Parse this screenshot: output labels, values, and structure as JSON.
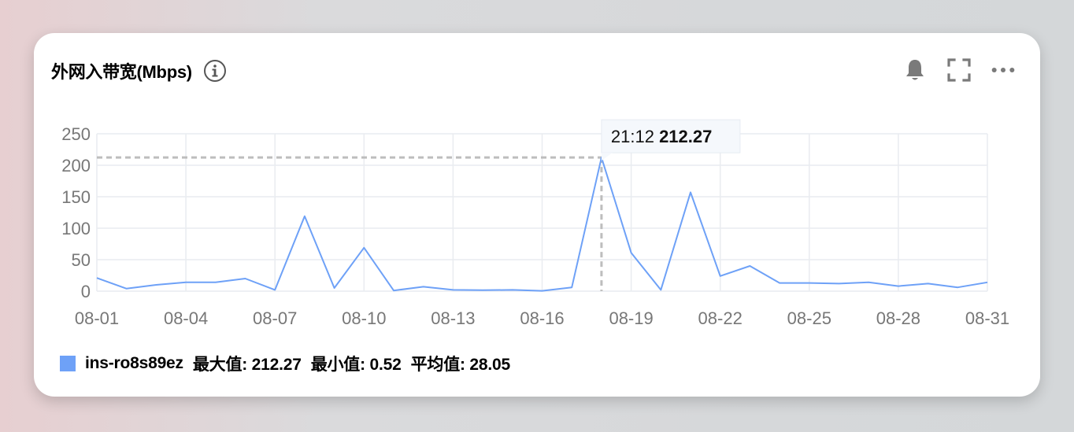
{
  "header": {
    "title": "外网入带宽(Mbps)"
  },
  "toolbar": {
    "icons": [
      "info-icon",
      "bell-icon",
      "fullscreen-icon",
      "more-icon"
    ]
  },
  "colors": {
    "series": "#6ea1f7",
    "grid": "#e9ecf0",
    "axis_text": "#777777",
    "crosshair": "#bdbdbd"
  },
  "legend": {
    "series_name": "ins-ro8s89ez",
    "max_text": "最大值: 212.27",
    "min_text": "最小值: 0.52",
    "avg_text": "平均值: 28.05"
  },
  "tooltip": {
    "time": "21:12",
    "value": "212.27",
    "day": "08-18"
  },
  "chart_data": {
    "type": "line",
    "x": [
      "08-01",
      "08-02",
      "08-03",
      "08-04",
      "08-05",
      "08-06",
      "08-07",
      "08-08",
      "08-09",
      "08-10",
      "08-11",
      "08-12",
      "08-13",
      "08-14",
      "08-15",
      "08-16",
      "08-17",
      "08-18",
      "08-19",
      "08-20",
      "08-21",
      "08-22",
      "08-23",
      "08-24",
      "08-25",
      "08-26",
      "08-27",
      "08-28",
      "08-29",
      "08-30",
      "08-31"
    ],
    "x_tick_labels": [
      "08-01",
      "08-04",
      "08-07",
      "08-10",
      "08-13",
      "08-16",
      "08-19",
      "08-22",
      "08-25",
      "08-28",
      "08-31"
    ],
    "y_ticks": [
      0,
      50,
      100,
      150,
      200,
      250
    ],
    "ylim": [
      0,
      250
    ],
    "grid": true,
    "series": [
      {
        "name": "ins-ro8s89ez",
        "values": [
          21,
          4,
          10,
          14,
          14,
          20,
          2,
          119,
          5,
          69,
          1,
          7,
          2,
          1.5,
          2,
          0.52,
          6,
          212.27,
          61,
          2,
          157,
          24,
          40,
          13,
          13,
          12,
          14,
          8,
          12,
          6,
          14
        ]
      }
    ]
  }
}
